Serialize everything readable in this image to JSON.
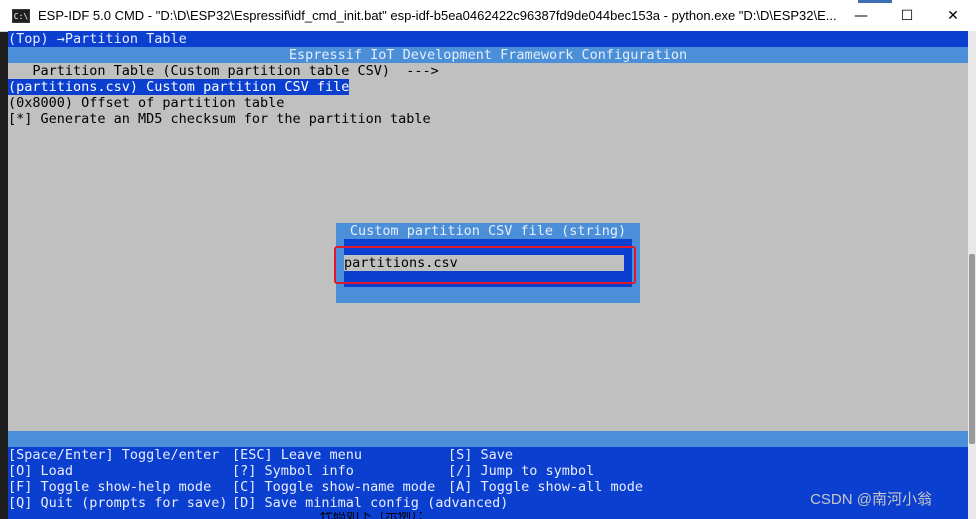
{
  "window": {
    "title": "ESP-IDF 5.0 CMD - \"D:\\D\\ESP32\\Espressif\\idf_cmd_init.bat\"  esp-idf-b5ea0462422c96387fd9de044bec153a - python.exe  \"D:\\D\\ESP32\\E...",
    "icon": "cmd-icon",
    "controls": {
      "minimize": "—",
      "maximize": "☐",
      "close": "✕"
    }
  },
  "terminal": {
    "breadcrumb": "(Top) →Partition Table",
    "header": "Espressif IoT Development Framework Configuration",
    "menu_items": [
      "   Partition Table (Custom partition table CSV)  --->",
      "(partitions.csv) Custom partition CSV file",
      "(0x8000) Offset of partition table",
      "[*] Generate an MD5 checksum for the partition table"
    ],
    "selected_index": 1
  },
  "dialog": {
    "title": "Custom partition CSV file (string)",
    "value": "partitions.csv"
  },
  "footer": {
    "col1": [
      "[Space/Enter] Toggle/enter",
      "[O] Load",
      "[F] Toggle show-help mode",
      "[Q] Quit (prompts for save)"
    ],
    "col2": [
      "[ESC] Leave menu",
      "[?] Symbol info",
      "[C] Toggle show-name mode",
      "[D] Save minimal config (advanced)"
    ],
    "col3": [
      "[S] Save",
      "[/] Jump to symbol",
      "[A] Toggle show-all mode"
    ]
  },
  "watermark": "CSDN @南河小翁",
  "bottom_text": "代码如下（示例）：",
  "colors": {
    "terminal_bg": "#c0c0c0",
    "dark_blue": "#0a3fd0",
    "light_blue": "#4a8fd8",
    "highlight_red": "#e0182d"
  }
}
